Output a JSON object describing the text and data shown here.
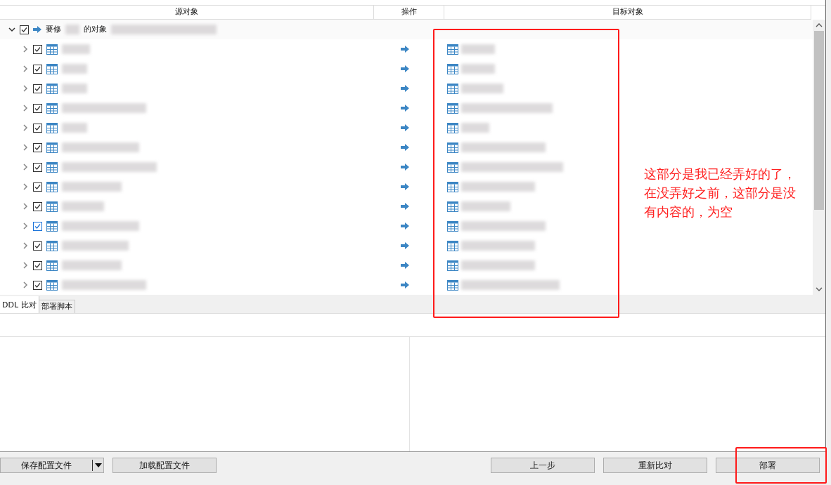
{
  "columns": [
    "源对象",
    "操作",
    "目标对象"
  ],
  "group": {
    "expanded": true,
    "checked": true,
    "label_start": "要修",
    "label_end": "的对象"
  },
  "rows": [
    {
      "expanded": false,
      "checked": true,
      "focused": false
    },
    {
      "expanded": false,
      "checked": true,
      "focused": false
    },
    {
      "expanded": false,
      "checked": true,
      "focused": false
    },
    {
      "expanded": false,
      "checked": true,
      "focused": false
    },
    {
      "expanded": false,
      "checked": true,
      "focused": false
    },
    {
      "expanded": false,
      "checked": true,
      "focused": false
    },
    {
      "expanded": false,
      "checked": true,
      "focused": false
    },
    {
      "expanded": false,
      "checked": true,
      "focused": false
    },
    {
      "expanded": false,
      "checked": true,
      "focused": false
    },
    {
      "expanded": false,
      "checked": true,
      "focused": true
    },
    {
      "expanded": false,
      "checked": true,
      "focused": false
    },
    {
      "expanded": false,
      "checked": true,
      "focused": false
    },
    {
      "expanded": false,
      "checked": true,
      "focused": false
    }
  ],
  "tabs": [
    {
      "label": "DDL 比对",
      "selected": true
    },
    {
      "label": "部署脚本",
      "selected": false
    }
  ],
  "buttons_left": [
    {
      "label": "保存配置文件",
      "kind": "split"
    },
    {
      "label": "加载配置文件",
      "kind": "plain"
    }
  ],
  "buttons_right": [
    {
      "label": "上一步"
    },
    {
      "label": "重新比对"
    },
    {
      "label": "部署"
    }
  ],
  "annotation": {
    "text": "这部分是我已经弄好的了，在没弄好之前，这部分是没有内容的，为空"
  }
}
